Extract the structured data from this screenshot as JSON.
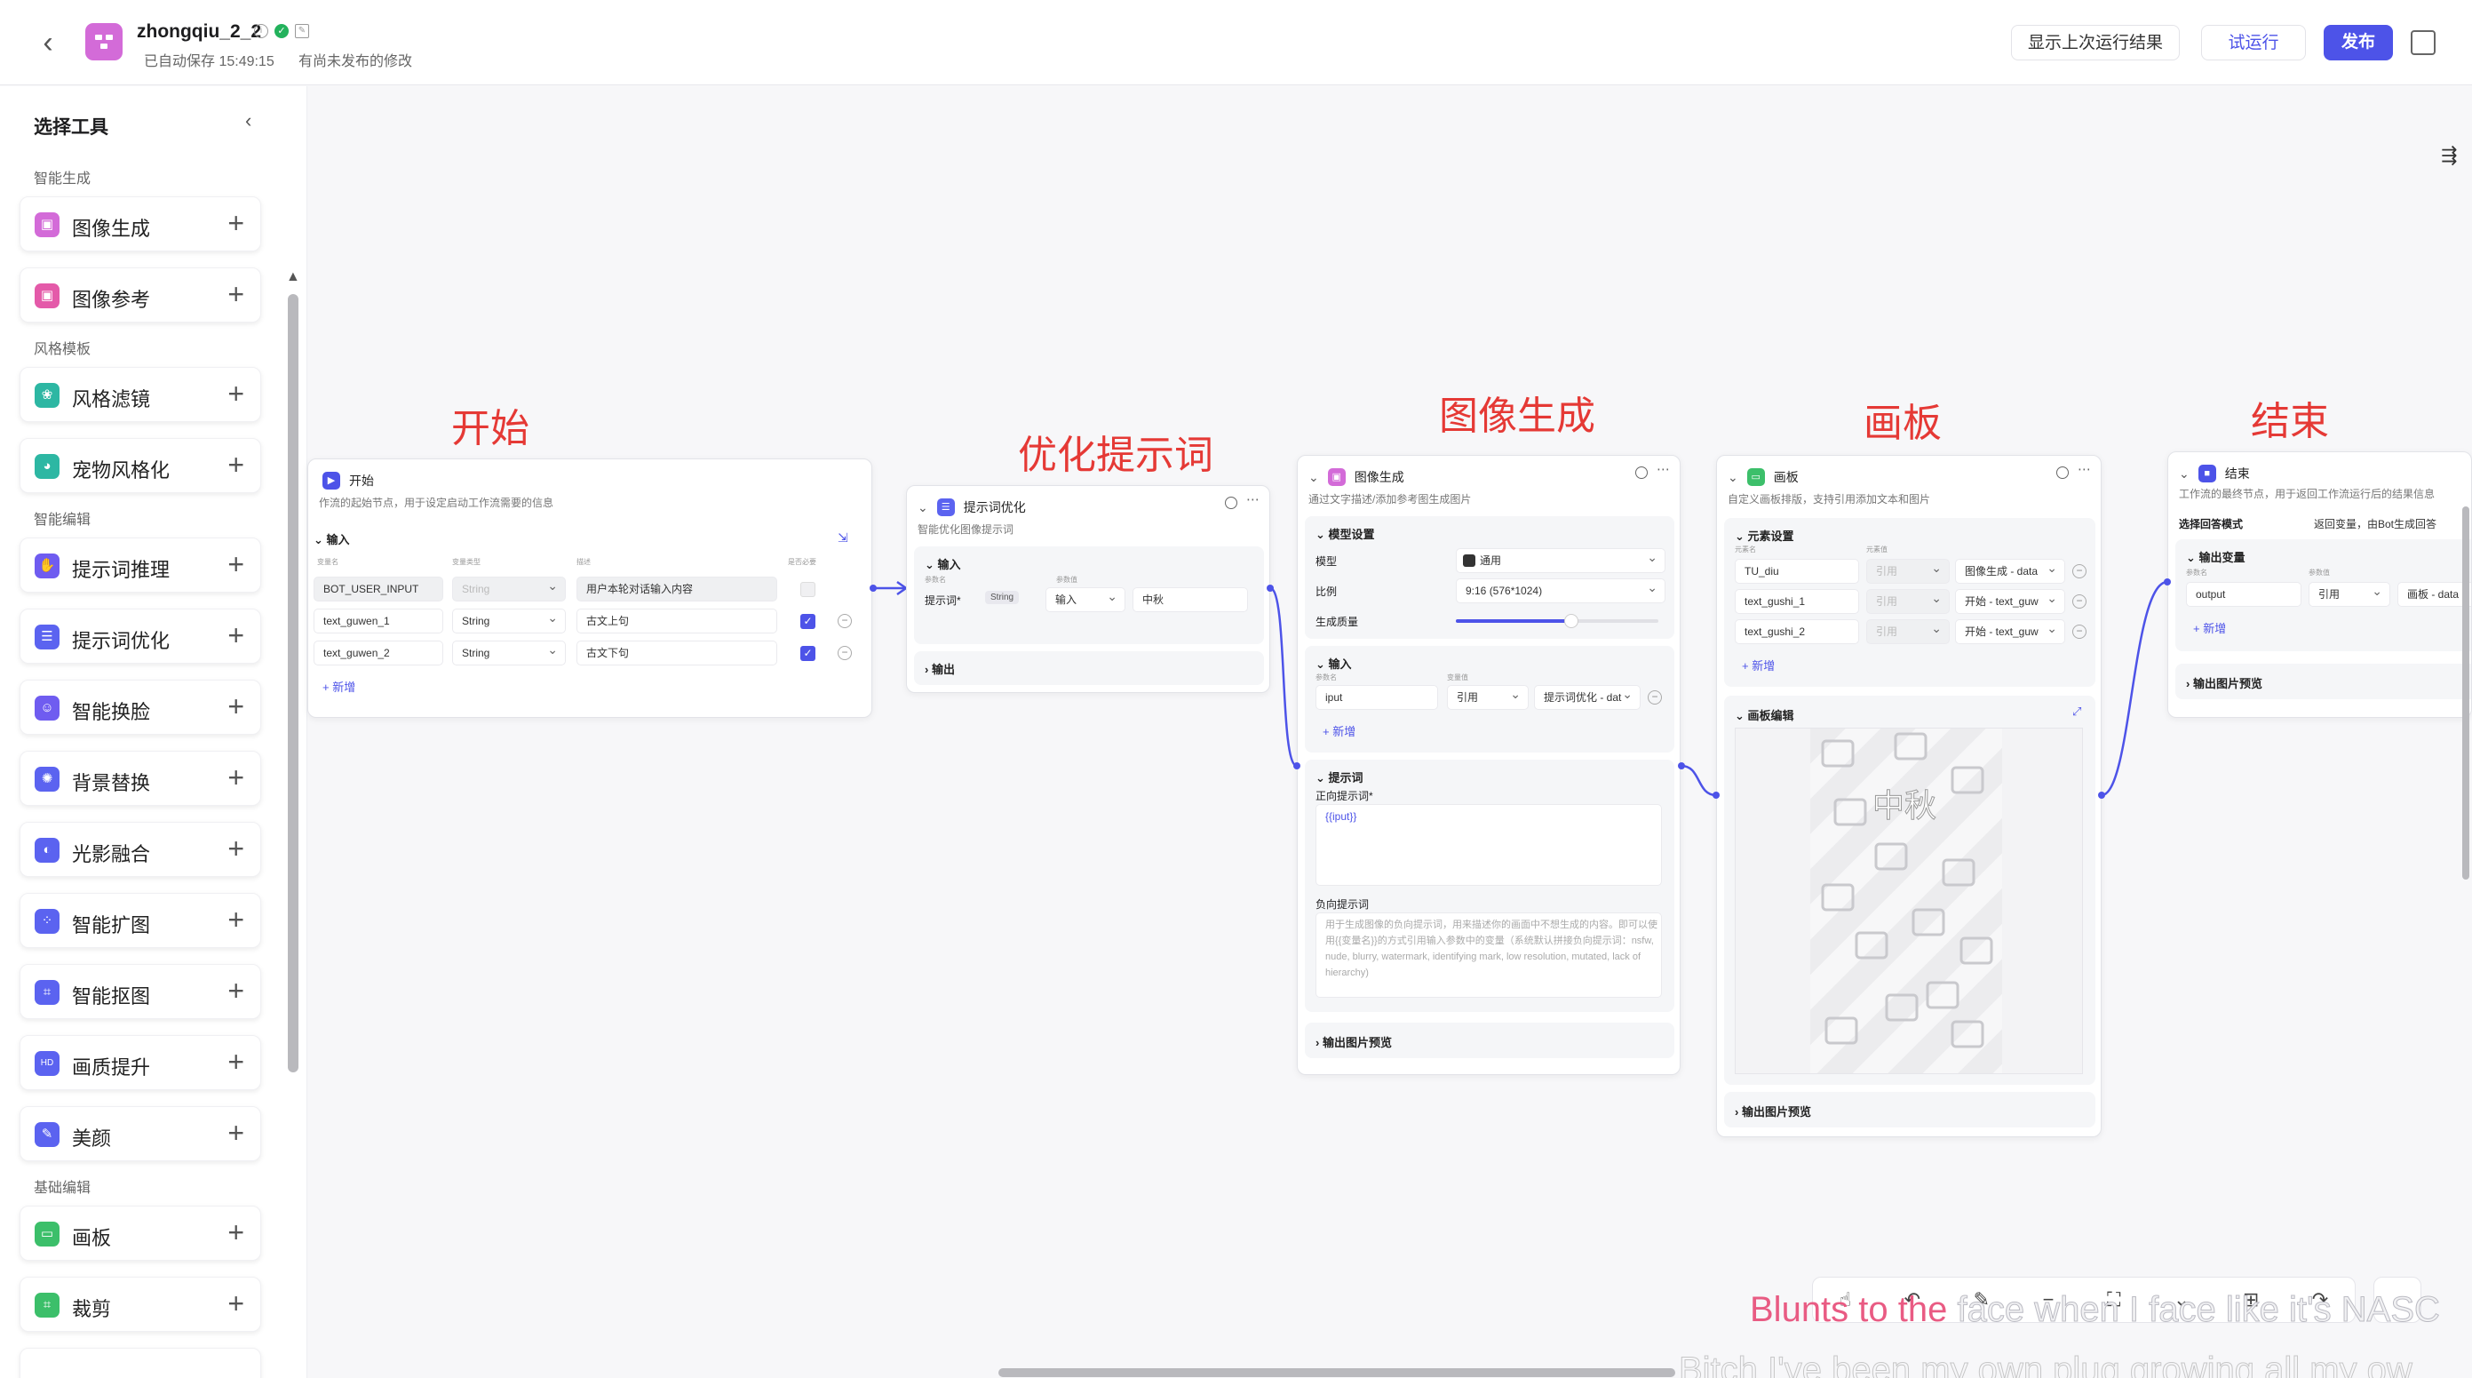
{
  "header": {
    "app_name": "zhongqiu_2_2",
    "save_status": "已自动保存 15:49:15",
    "unpublished": "有尚未发布的修改",
    "show_last_run": "显示上次运行结果",
    "test_run": "试运行",
    "publish": "发布"
  },
  "sidebar": {
    "title": "选择工具",
    "sections": [
      {
        "label": "智能生成"
      },
      {
        "label": "风格模板"
      },
      {
        "label": "智能编辑"
      },
      {
        "label": "基础编辑"
      }
    ],
    "tools": [
      {
        "label": "图像生成",
        "icon": "image-generate-icon",
        "color": "#d36bd8"
      },
      {
        "label": "图像参考",
        "icon": "image-reference-icon",
        "color": "#e45aa9"
      },
      {
        "label": "风格滤镜",
        "icon": "style-filter-icon",
        "color": "#2db7a3"
      },
      {
        "label": "宠物风格化",
        "icon": "pet-style-icon",
        "color": "#2db7a3"
      },
      {
        "label": "提示词推理",
        "icon": "prompt-reason-icon",
        "color": "#6f5cf0"
      },
      {
        "label": "提示词优化",
        "icon": "prompt-optimize-icon",
        "color": "#5b63f0"
      },
      {
        "label": "智能换脸",
        "icon": "face-swap-icon",
        "color": "#6f5cf0"
      },
      {
        "label": "背景替换",
        "icon": "background-replace-icon",
        "color": "#5b63f0"
      },
      {
        "label": "光影融合",
        "icon": "light-blend-icon",
        "color": "#5b63f0"
      },
      {
        "label": "智能扩图",
        "icon": "image-expand-icon",
        "color": "#5b63f0"
      },
      {
        "label": "智能抠图",
        "icon": "cutout-icon",
        "color": "#5b63f0"
      },
      {
        "label": "画质提升",
        "icon": "quality-upscale-icon",
        "color": "#5b63f0"
      },
      {
        "label": "美颜",
        "icon": "beauty-icon",
        "color": "#5b63f0"
      },
      {
        "label": "画板",
        "icon": "canvas-board-icon",
        "color": "#3cbf6a"
      },
      {
        "label": "裁剪",
        "icon": "crop-icon",
        "color": "#3cbf6a"
      }
    ]
  },
  "annotations": {
    "start": "开始",
    "optimize": "优化提示词",
    "image_gen": "图像生成",
    "board": "画板",
    "end": "结束"
  },
  "nodes": {
    "start": {
      "title": "开始",
      "desc": "作流的起始节点，用于设定启动工作流需要的信息",
      "input_label": "输入",
      "col_name": "变量名",
      "col_type": "变量类型",
      "col_desc": "描述",
      "col_required": "是否必要",
      "rows": [
        {
          "name": "BOT_USER_INPUT",
          "type": "String",
          "desc": "用户本轮对话输入内容"
        },
        {
          "name": "text_guwen_1",
          "type": "String",
          "desc": "古文上句"
        },
        {
          "name": "text_guwen_2",
          "type": "String",
          "desc": "古文下句"
        }
      ],
      "add": "+ 新增"
    },
    "optimize": {
      "title": "提示词优化",
      "desc": "智能优化图像提示词",
      "input_label": "输入",
      "col_name": "参数名",
      "col_value": "参数值",
      "param": "提示词*",
      "param_type": "String",
      "mode": "输入",
      "value": "中秋",
      "output_label": "输出"
    },
    "imagegen": {
      "title": "图像生成",
      "desc": "通过文字描述/添加参考图生成图片",
      "model_settings": "模型设置",
      "model_label": "模型",
      "model_value": "通用",
      "ratio_label": "比例",
      "ratio_value": "9:16 (576*1024)",
      "quality_label": "生成质量",
      "quality_value": 0.57,
      "input_label": "输入",
      "col_name": "参数名",
      "col_value": "变量值",
      "input_name": "iput",
      "input_mode": "引用",
      "input_ref": "提示词优化 - dat",
      "add": "+ 新增",
      "prompt_label": "提示词",
      "positive_label": "正向提示词*",
      "positive_value": "{{iput}}",
      "negative_label": "负向提示词",
      "negative_placeholder": "用于生成图像的负向提示词，用来描述你的画面中不想生成的内容。即可以使用{{变量名}}的方式引用输入参数中的变量（系统默认拼接负向提示词：nsfw, nude, blurry, watermark, identifying mark, low resolution, mutated, lack of hierarchy)",
      "output_preview": "输出图片预览"
    },
    "board": {
      "title": "画板",
      "desc": "自定义画板排版，支持引用添加文本和图片",
      "element_settings": "元素设置",
      "col_name": "元素名",
      "col_value": "元素值",
      "rows": [
        {
          "name": "TU_diu",
          "mode": "引用",
          "ref": "图像生成 - data"
        },
        {
          "name": "text_gushi_1",
          "mode": "引用",
          "ref": "开始 - text_guw"
        },
        {
          "name": "text_gushi_2",
          "mode": "引用",
          "ref": "开始 - text_guw"
        }
      ],
      "add": "+ 新增",
      "board_edit": "画板编辑",
      "board_text": "中秋",
      "output_preview": "输出图片预览"
    },
    "end": {
      "title": "结束",
      "desc": "工作流的最终节点，用于返回工作流运行后的结果信息",
      "answer_mode_label": "选择回答模式",
      "answer_mode_value": "返回变量，由Bot生成回答",
      "output_var_label": "输出变量",
      "col_name": "参数名",
      "col_value": "参数值",
      "output_name": "output",
      "output_mode": "引用",
      "output_ref": "画板 - data",
      "add": "+ 新增",
      "output_preview": "输出图片预览"
    }
  },
  "subtitles": {
    "line1_prefix": "Blunts to the",
    "line1_rest": " face when I face like it's NASC",
    "line2": "Bitch I've been my own plug growing all my ow"
  }
}
